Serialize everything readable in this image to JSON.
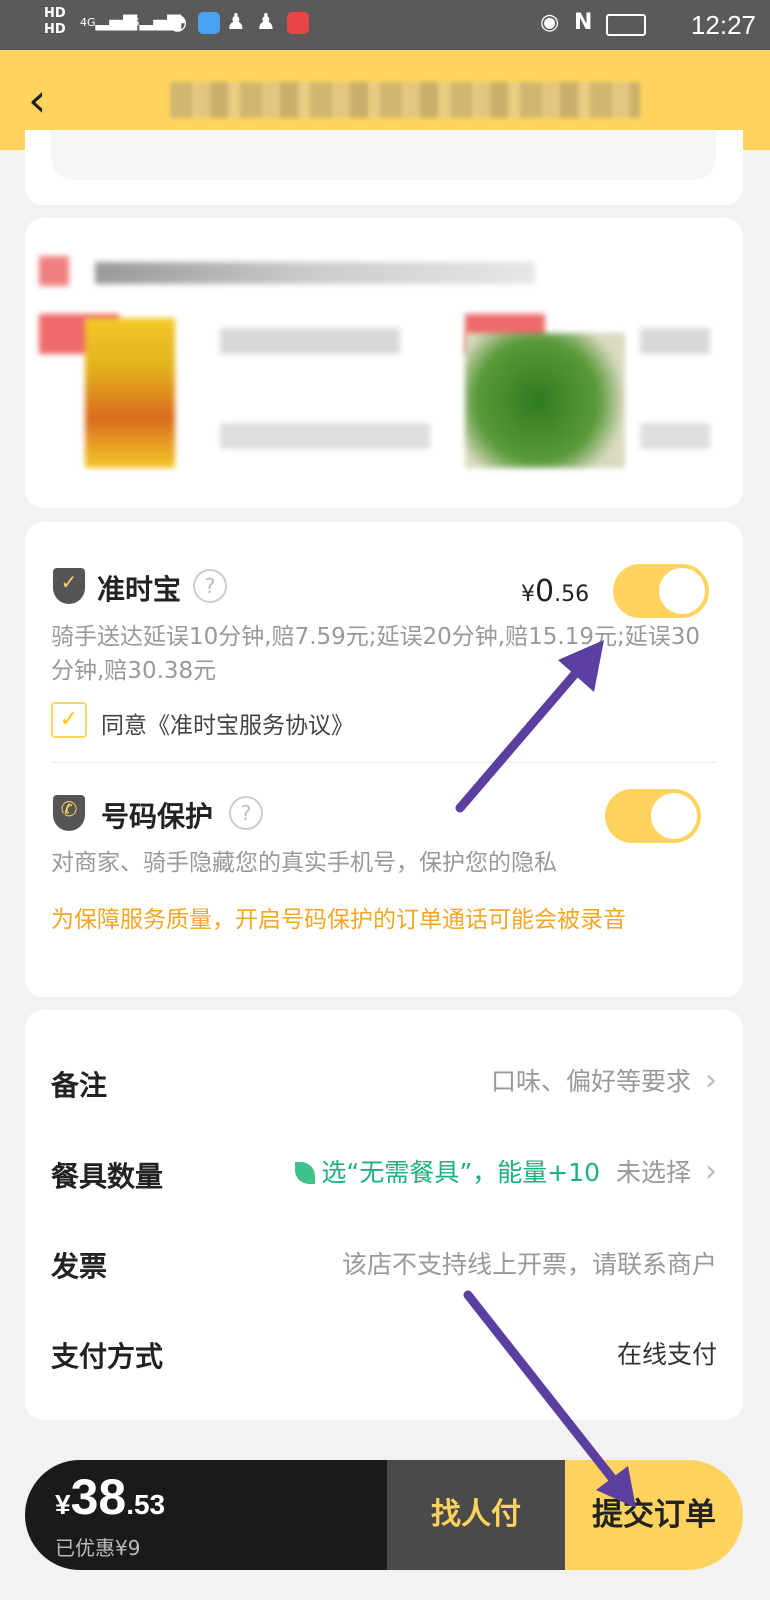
{
  "status_bar": {
    "network_1": "HD",
    "network_2": "HD",
    "signal": "4G",
    "time": "12:27"
  },
  "header": {
    "back_icon": "chevron-left-icon"
  },
  "service": {
    "ontime": {
      "title": "准时宝",
      "price_symbol": "¥",
      "price_int": "0",
      "price_dec": ".56",
      "desc": "骑手送达延误10分钟,赔7.59元;延误20分钟,赔15.19元;延误30分钟,赔30.38元",
      "agree_text": "同意《准时宝服务协议》",
      "enabled": true,
      "agreed": true
    },
    "phone": {
      "title": "号码保护",
      "desc": "对商家、骑手隐藏您的真实手机号，保护您的隐私",
      "warning": "为保障服务质量，开启号码保护的订单通话可能会被录音",
      "enabled": true
    }
  },
  "options": {
    "remark": {
      "label": "备注",
      "value": "口味、偏好等要求"
    },
    "tableware": {
      "label": "餐具数量",
      "promo": "选“无需餐具”，能量+10",
      "value": "未选择"
    },
    "invoice": {
      "label": "发票",
      "value": "该店不支持线上开票，请联系商户"
    },
    "payment": {
      "label": "支付方式",
      "value": "在线支付"
    }
  },
  "paybar": {
    "currency": "¥",
    "total_int": "38",
    "total_dec": ".53",
    "discount": "已优惠¥9",
    "friend_pay": "找人付",
    "submit": "提交订单"
  },
  "colors": {
    "brand_yellow": "#ffd35e",
    "warning_orange": "#f5a623",
    "promo_green": "#1bb080",
    "annotation_arrow": "#5b3fa0"
  }
}
